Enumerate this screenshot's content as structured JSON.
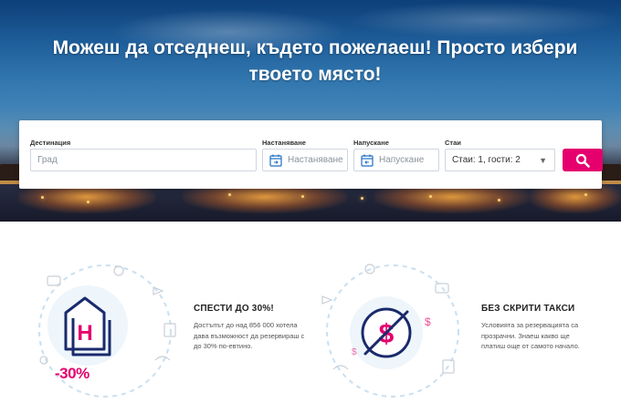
{
  "hero": {
    "title_line1": "Можеш да отседнеш, където пожелаеш! Просто избери",
    "title_line2": "твоето място!"
  },
  "search": {
    "destination_label": "Дестинация",
    "destination_placeholder": "Град",
    "checkin_label": "Настаняване",
    "checkin_placeholder": "Настаняване",
    "checkout_label": "Напускане",
    "checkout_placeholder": "Напускане",
    "rooms_label": "Стаи",
    "rooms_value": "Стаи: 1, гости: 2",
    "accent_color": "#e5006d"
  },
  "features": [
    {
      "title": "СПЕСТИ ДО 30%!",
      "text_lines": [
        "Достъпът до над 856 000 хотела",
        "дава възможност да резервираш с",
        "до 30% по-евтино."
      ],
      "badge": "-30%",
      "icon": "hotel-h-icon"
    },
    {
      "title": "БЕЗ СКРИТИ ТАКСИ",
      "text_lines": [
        "Условията за резервацията са",
        "прозрачни. Знаеш какво ще",
        "платиш още от самото начало."
      ],
      "icon": "no-dollar-icon"
    }
  ]
}
